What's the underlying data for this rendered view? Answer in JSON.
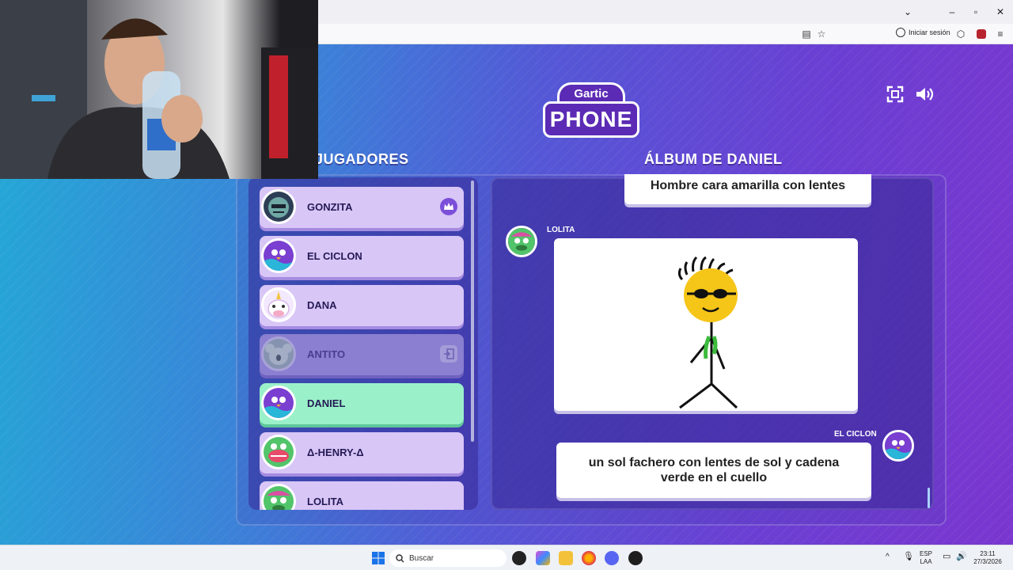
{
  "browser": {
    "signin_label": "Iniciar sesión"
  },
  "game": {
    "logo_top": "Gartic",
    "logo_bottom": "PHONE",
    "players_heading": "JUGADORES",
    "album_heading": "ÁLBUM DE DANIEL",
    "players": [
      {
        "name": "GONZITA",
        "status": "host"
      },
      {
        "name": "EL CICLON",
        "status": "normal"
      },
      {
        "name": "DANA",
        "status": "normal"
      },
      {
        "name": "ANTITO",
        "status": "away"
      },
      {
        "name": "DANIEL",
        "status": "current"
      },
      {
        "name": "Δ-HENRY-Δ",
        "status": "normal"
      },
      {
        "name": "LOLITA",
        "status": "normal"
      }
    ],
    "album": {
      "first_text": "Hombre cara amarilla con lentes",
      "drawing_author": "LOLITA",
      "caption_author": "EL CICLON",
      "caption_text": "un sol fachero con lentes de sol y cadena verde en el cuello"
    }
  },
  "taskbar": {
    "search_placeholder": "Buscar",
    "lang_top": "ESP",
    "lang_bottom": "LAA",
    "time": "23:11",
    "date": "27/3/2026"
  },
  "colors": {
    "player_card": "#d8c6f7",
    "current_player_card": "#9af0c8",
    "away_player_card": "#8a7fd0",
    "heading_text": "#ffffff"
  }
}
